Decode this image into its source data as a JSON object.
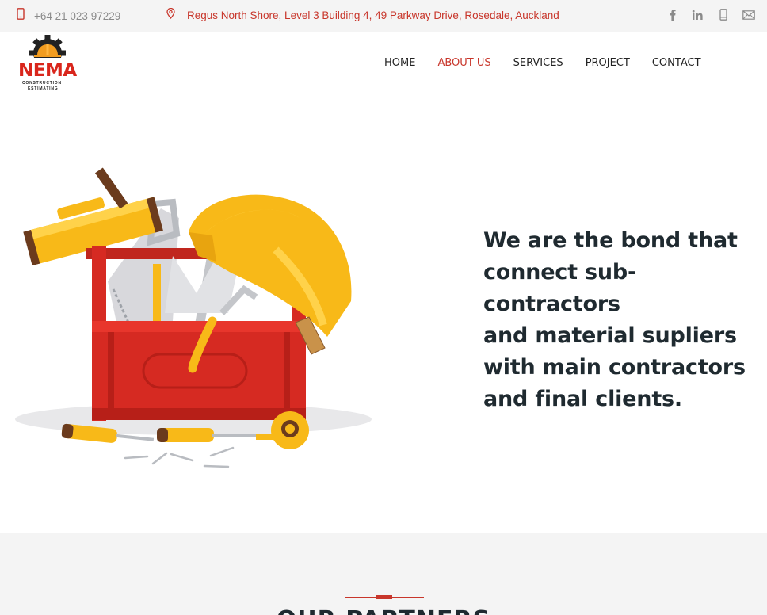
{
  "topbar": {
    "phone": "+64 21 023 97229",
    "address": "Regus North Shore, Level 3 Building 4, 49 Parkway Drive, Rosedale, Auckland",
    "social": [
      "facebook-icon",
      "linkedin-icon",
      "mobile-icon",
      "mail-icon"
    ]
  },
  "logo": {
    "brand": "NEMA",
    "line1": "CONSTRUCTION",
    "line2": "ESTIMATING"
  },
  "nav": {
    "items": [
      "HOME",
      "ABOUT US",
      "SERVICES",
      "PROJECT",
      "CONTACT"
    ],
    "active": "ABOUT US"
  },
  "hero": {
    "line1": "We are the bond that",
    "line2": "connect sub-contractors",
    "line3": "and material supliers",
    "line4": "with main contractors",
    "line5": "and final clients."
  },
  "partners": {
    "heading": "OUR PARTNERS"
  },
  "colors": {
    "accent": "#c8362b",
    "topbar_bg": "#f4f4f4",
    "heading_text": "#1f2a30"
  }
}
